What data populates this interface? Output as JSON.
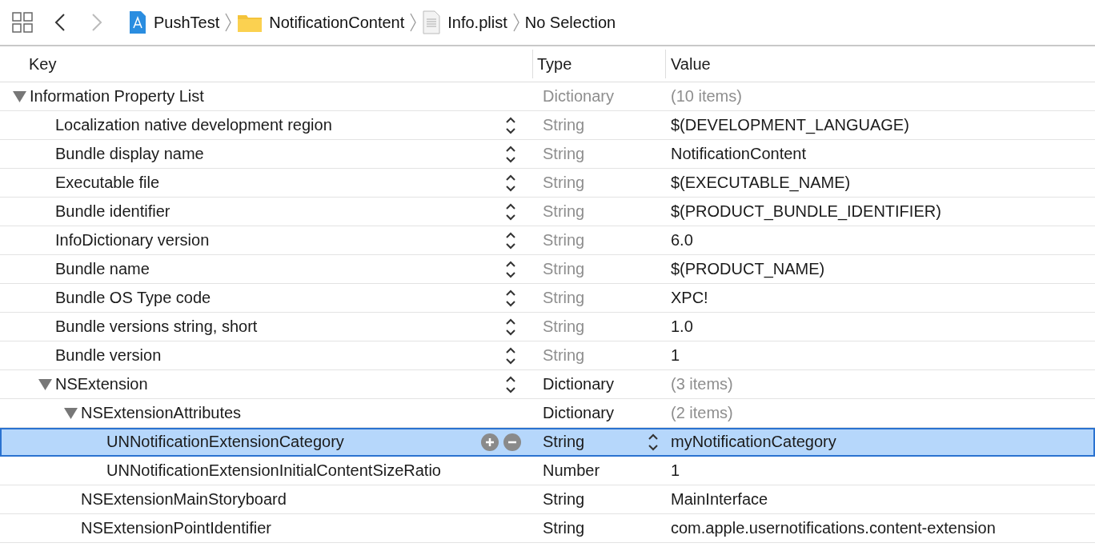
{
  "toolbar": {
    "back_enabled": true,
    "forward_enabled": false
  },
  "breadcrumbs": [
    {
      "label": "PushTest",
      "kind": "project"
    },
    {
      "label": "NotificationContent",
      "kind": "folder"
    },
    {
      "label": "Info.plist",
      "kind": "plist"
    },
    {
      "label": "No Selection",
      "kind": "none"
    }
  ],
  "table": {
    "columns": [
      "Key",
      "Type",
      "Value"
    ],
    "rows": [
      {
        "key": "Information Property List",
        "type": "Dictionary",
        "value": "(10 items)",
        "type_muted": true,
        "value_muted": true,
        "stepper": false,
        "selected": false,
        "expanded": true,
        "children": [
          {
            "key": "Localization native development region",
            "type": "String",
            "value": "$(DEVELOPMENT_LANGUAGE)",
            "type_muted": true,
            "value_muted": false,
            "stepper": true,
            "selected": false
          },
          {
            "key": "Bundle display name",
            "type": "String",
            "value": "NotificationContent",
            "type_muted": true,
            "value_muted": false,
            "stepper": true,
            "selected": false
          },
          {
            "key": "Executable file",
            "type": "String",
            "value": "$(EXECUTABLE_NAME)",
            "type_muted": true,
            "value_muted": false,
            "stepper": true,
            "selected": false
          },
          {
            "key": "Bundle identifier",
            "type": "String",
            "value": "$(PRODUCT_BUNDLE_IDENTIFIER)",
            "type_muted": true,
            "value_muted": false,
            "stepper": true,
            "selected": false
          },
          {
            "key": "InfoDictionary version",
            "type": "String",
            "value": "6.0",
            "type_muted": true,
            "value_muted": false,
            "stepper": true,
            "selected": false
          },
          {
            "key": "Bundle name",
            "type": "String",
            "value": "$(PRODUCT_NAME)",
            "type_muted": true,
            "value_muted": false,
            "stepper": true,
            "selected": false
          },
          {
            "key": "Bundle OS Type code",
            "type": "String",
            "value": "XPC!",
            "type_muted": true,
            "value_muted": false,
            "stepper": true,
            "selected": false
          },
          {
            "key": "Bundle versions string, short",
            "type": "String",
            "value": "1.0",
            "type_muted": true,
            "value_muted": false,
            "stepper": true,
            "selected": false
          },
          {
            "key": "Bundle version",
            "type": "String",
            "value": "1",
            "type_muted": true,
            "value_muted": false,
            "stepper": true,
            "selected": false
          },
          {
            "key": "NSExtension",
            "type": "Dictionary",
            "value": "(3 items)",
            "type_muted": false,
            "value_muted": true,
            "stepper": true,
            "selected": false,
            "expanded": true,
            "children": [
              {
                "key": "NSExtensionAttributes",
                "type": "Dictionary",
                "value": "(2 items)",
                "type_muted": false,
                "value_muted": true,
                "stepper": false,
                "selected": false,
                "expanded": true,
                "children": [
                  {
                    "key": "UNNotificationExtensionCategory",
                    "type": "String",
                    "value": "myNotificationCategory",
                    "type_muted": false,
                    "value_muted": false,
                    "stepper": false,
                    "selected": true
                  },
                  {
                    "key": "UNNotificationExtensionInitialContentSizeRatio",
                    "type": "Number",
                    "value": "1",
                    "type_muted": false,
                    "value_muted": false,
                    "stepper": false,
                    "selected": false
                  }
                ]
              },
              {
                "key": "NSExtensionMainStoryboard",
                "type": "String",
                "value": "MainInterface",
                "type_muted": false,
                "value_muted": false,
                "stepper": false,
                "selected": false
              },
              {
                "key": "NSExtensionPointIdentifier",
                "type": "String",
                "value": "com.apple.usernotifications.content-extension",
                "type_muted": false,
                "value_muted": false,
                "stepper": false,
                "selected": false
              }
            ]
          }
        ]
      }
    ]
  }
}
